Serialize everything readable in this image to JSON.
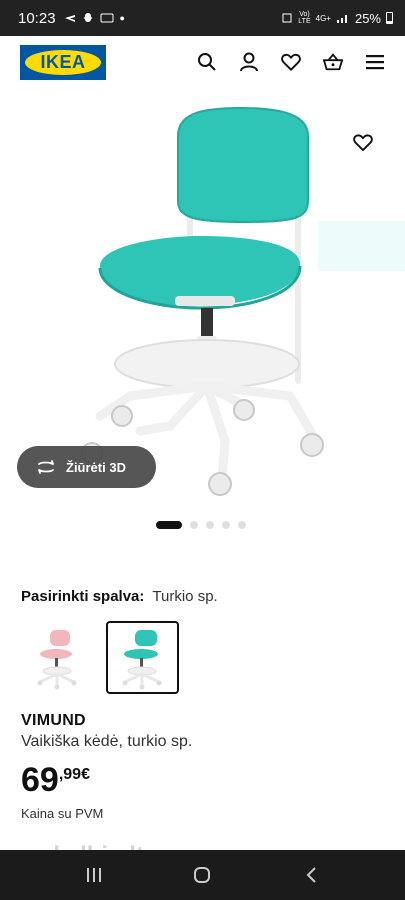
{
  "status_bar": {
    "time": "10:23",
    "network_tiny_top": "Vo)",
    "network_tiny_bottom": "LTE",
    "network_gen": "4G+",
    "battery": "25%"
  },
  "header": {
    "logo_text": "IKEA",
    "icons": [
      "search-icon",
      "account-icon",
      "wishlist-icon",
      "basket-icon",
      "menu-icon"
    ]
  },
  "gallery": {
    "view_3d_label": "Žiūrėti 3D",
    "total_images": 5,
    "active_index": 0
  },
  "color_select": {
    "label": "Pasirinkti spalva:",
    "value": "Turkio sp.",
    "options": [
      {
        "name": "pink",
        "color": "#f2b6bd",
        "selected": false
      },
      {
        "name": "turquoise",
        "color": "#2ec4b6",
        "selected": true
      }
    ]
  },
  "product": {
    "name": "VIMUND",
    "description": "Vaikiška kėdė, turkio sp.",
    "price_int": "69",
    "price_cents": ",99",
    "price_currency": "€",
    "vat_note": "Kaina su PVM"
  },
  "watermark": "skelbiu.lt",
  "colors": {
    "ikea_blue": "#0058a3",
    "ikea_yellow": "#ffdb00",
    "seat_turquoise": "#2ec4b6"
  }
}
